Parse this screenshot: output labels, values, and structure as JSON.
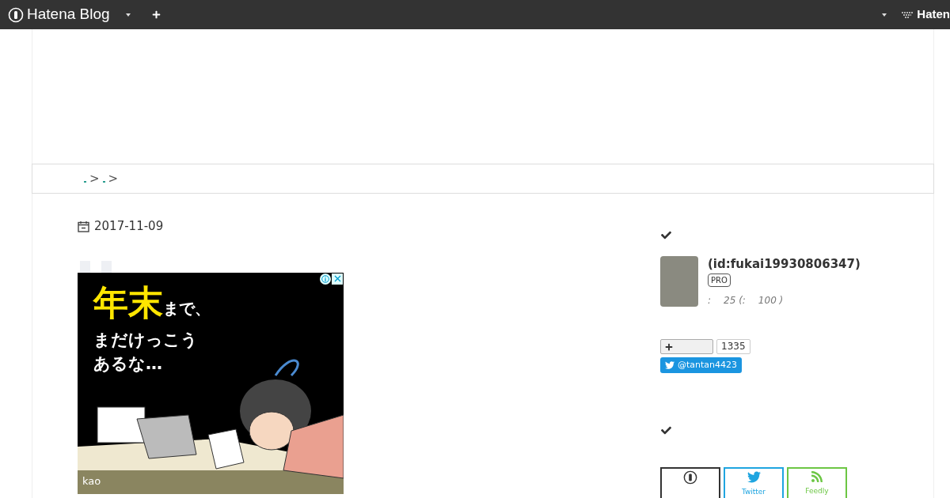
{
  "topbar": {
    "logo": "Hatena Blog",
    "right_logo": "Haten"
  },
  "breadcrumb": {
    "separators": [
      ">",
      ">"
    ]
  },
  "entry": {
    "date": "2017-11-09",
    "ad": {
      "headline_big": "年末",
      "headline_small": "まで、",
      "line_2": "まだけっこう",
      "line_3": "あるな…",
      "brand": "kao"
    }
  },
  "sidebar": {
    "profile": {
      "id": "(id:fukai19930806347)",
      "badge": "PRO",
      "stats": [
        ":",
        "25 (:",
        "100 )"
      ]
    },
    "follow": {
      "count": "1335"
    },
    "twitter": {
      "handle": "@tantan4423"
    },
    "subscribe": [
      {
        "kind": "hatena"
      },
      {
        "kind": "twitter",
        "label": "Twitter"
      },
      {
        "kind": "feedly",
        "label": "Feedly"
      }
    ]
  }
}
